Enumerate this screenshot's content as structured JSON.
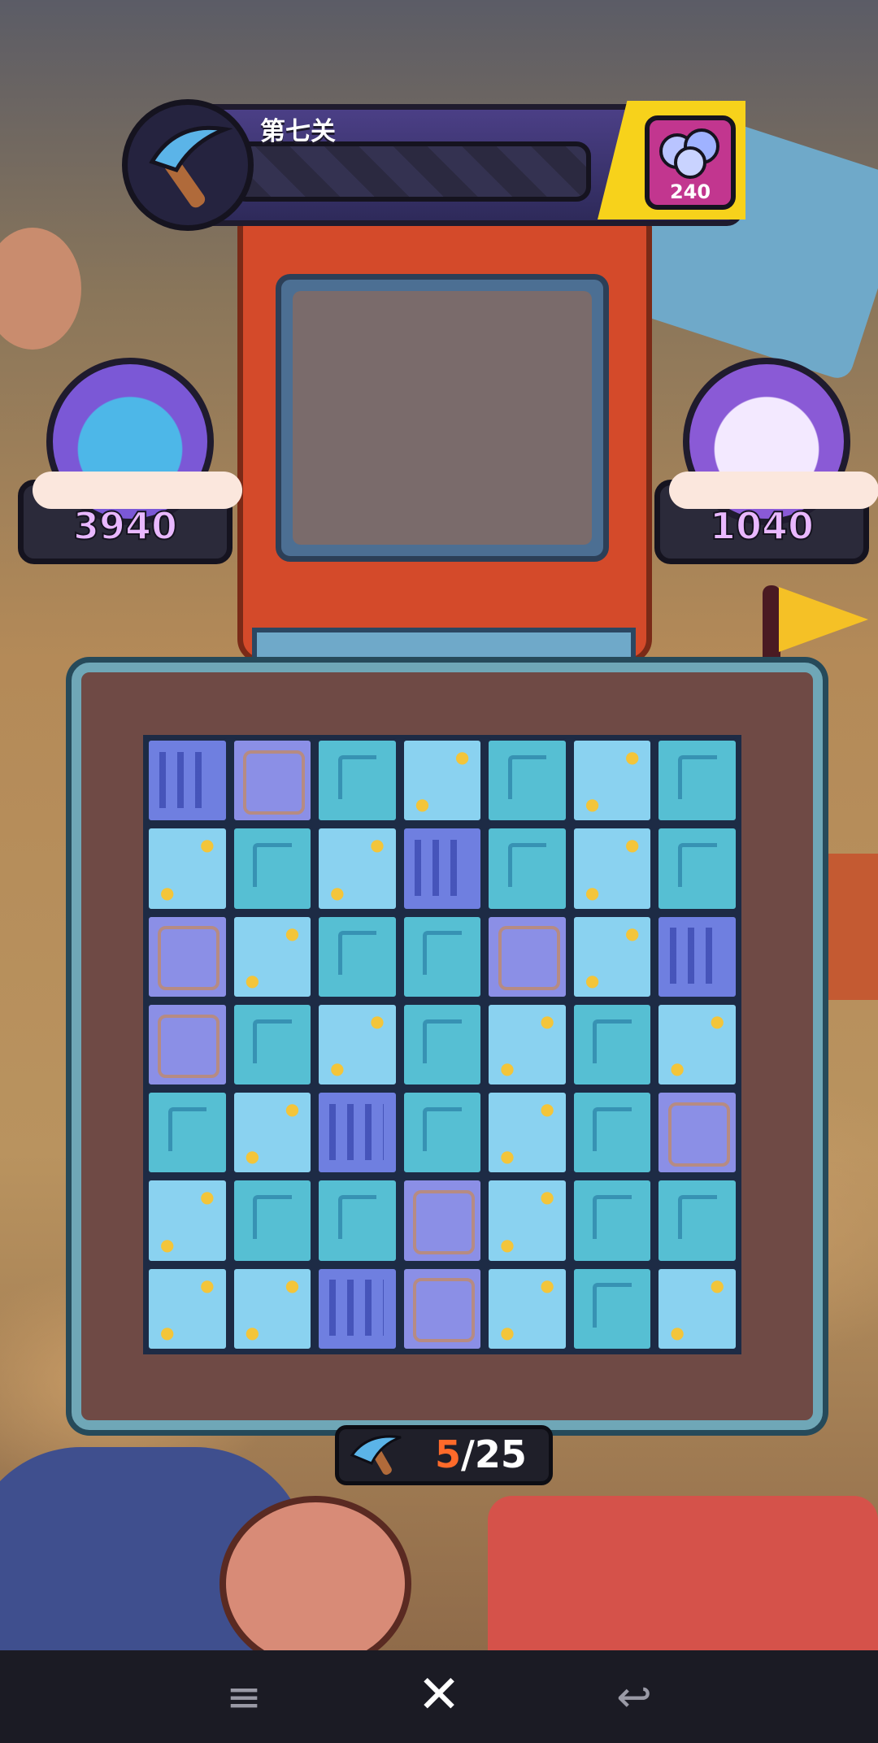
{
  "hud": {
    "level_label": "第七关",
    "tool_icon": "pickaxe-icon",
    "reward_icon": "gem-bundle-icon",
    "reward_count": "240"
  },
  "players": {
    "left": {
      "score": "3940",
      "avatar_icon": "blue-creature-avatar"
    },
    "right": {
      "score": "1040",
      "avatar_icon": "purple-cat-girl-avatar"
    }
  },
  "board": {
    "rows": 7,
    "cols": 7,
    "tiles": [
      [
        "c",
        "d",
        "b",
        "a",
        "b",
        "a",
        "b"
      ],
      [
        "a",
        "b",
        "a",
        "c",
        "b",
        "a",
        "b"
      ],
      [
        "d",
        "a",
        "b",
        "b",
        "d",
        "a",
        "c"
      ],
      [
        "d",
        "b",
        "a",
        "b",
        "a",
        "b",
        "a"
      ],
      [
        "b",
        "a",
        "c",
        "b",
        "a",
        "b",
        "d"
      ],
      [
        "a",
        "b",
        "b",
        "d",
        "a",
        "b",
        "b"
      ],
      [
        "a",
        "a",
        "c",
        "d",
        "a",
        "b",
        "a"
      ]
    ]
  },
  "moves": {
    "current": "5",
    "separator": "/",
    "total": "25"
  },
  "nav": {
    "menu_icon": "≡",
    "close_icon": "✕",
    "back_icon": "↩"
  },
  "colors": {
    "accent": "#f7d21b",
    "moves_current": "#ff6a2a",
    "score": "#e9b8ff"
  }
}
